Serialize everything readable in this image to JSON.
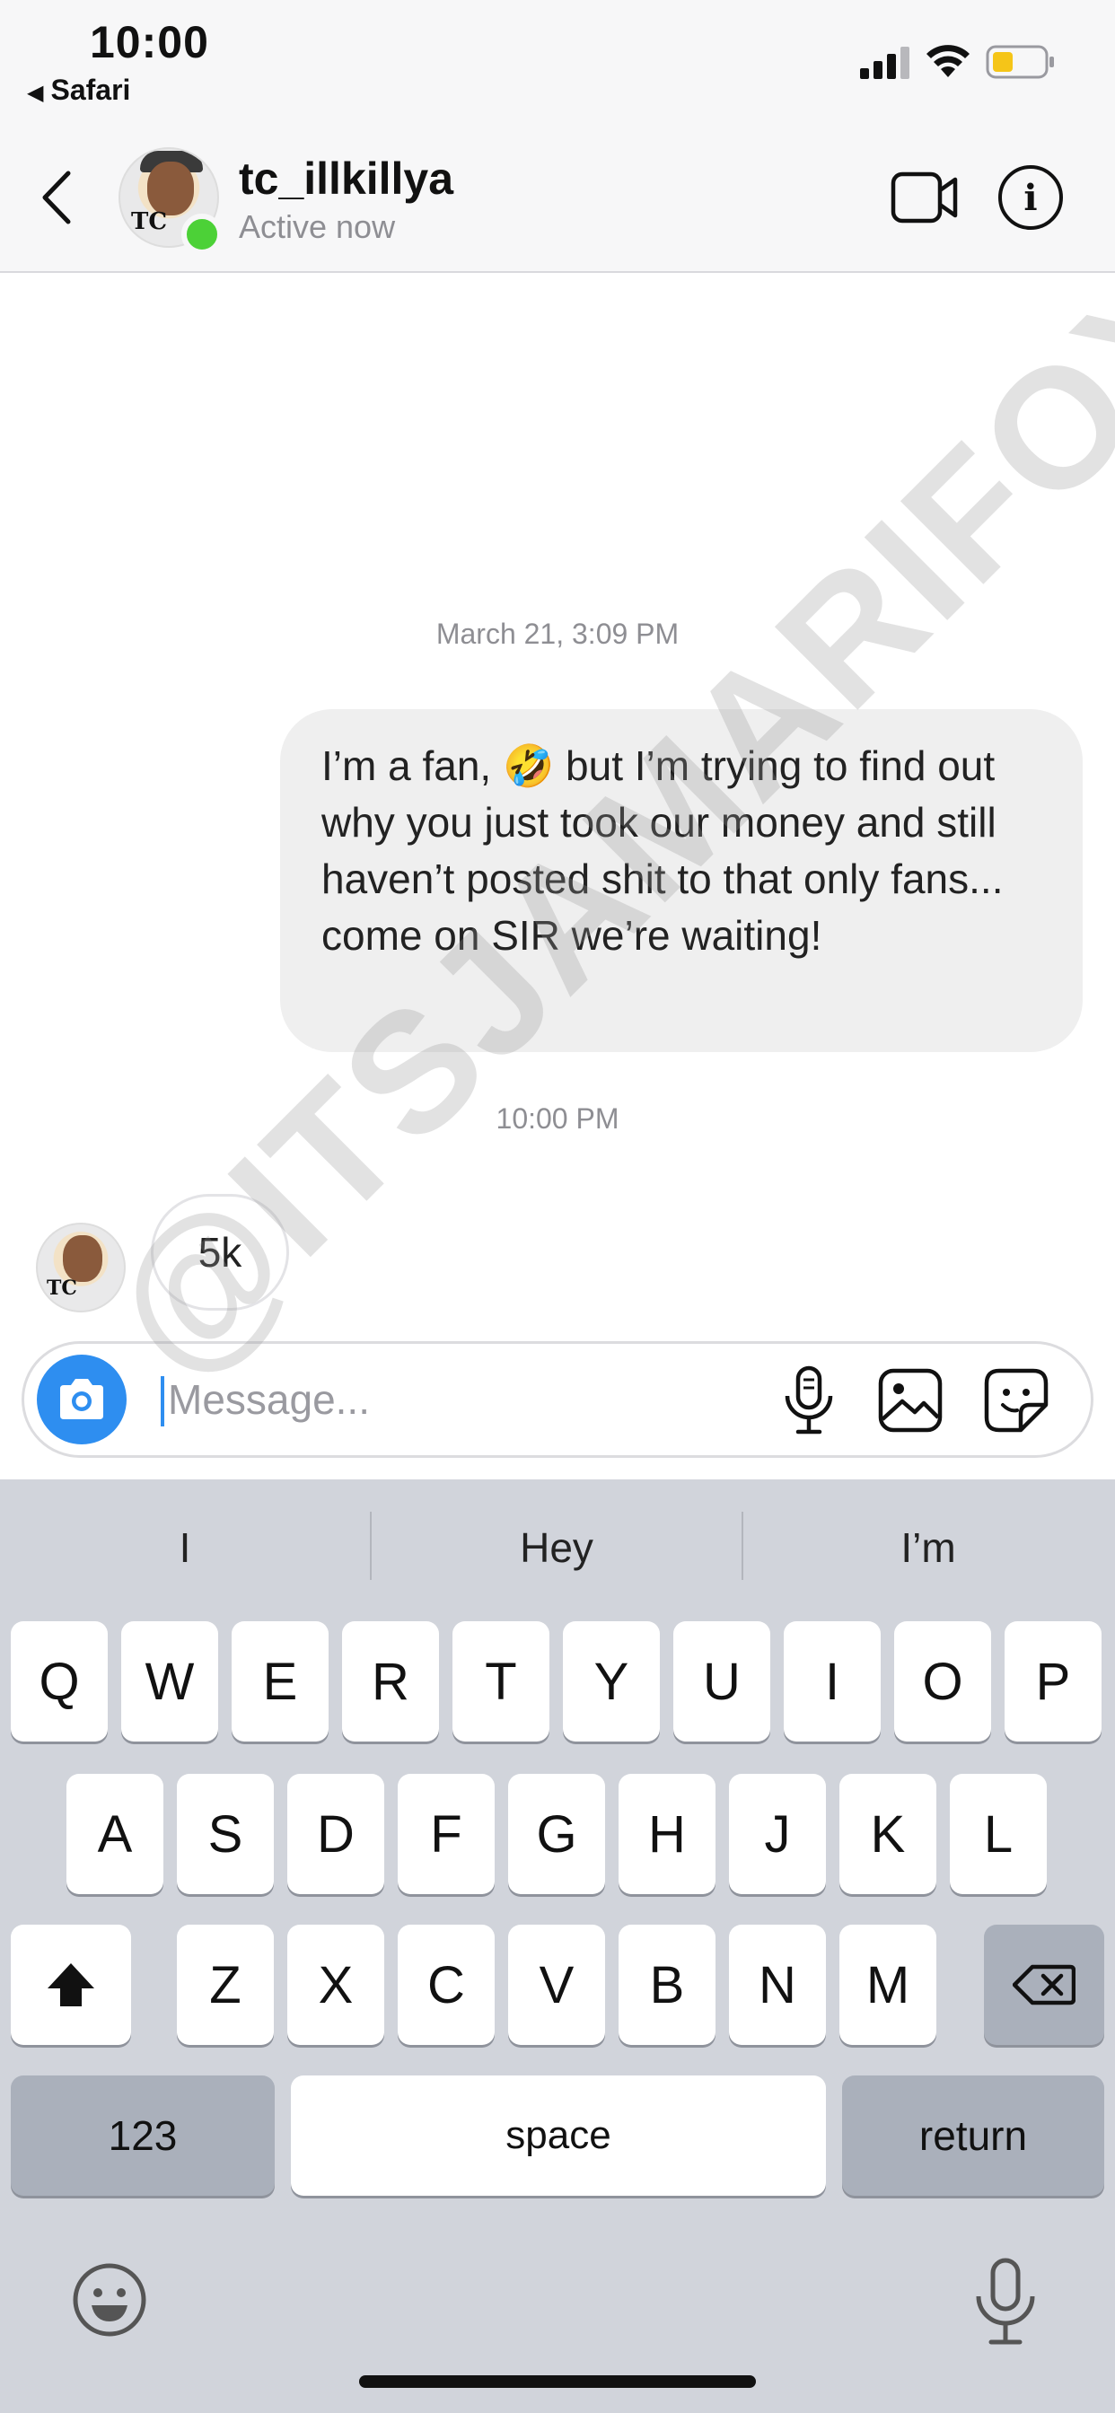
{
  "status_bar": {
    "time": "10:00",
    "back_app": "Safari",
    "battery_color": "#f5c518"
  },
  "header": {
    "username": "tc_illkillya",
    "status": "Active now",
    "avatar_badge": "TC",
    "online_color": "#4cd137"
  },
  "chat": {
    "date_stamp": "March 21, 3:09 PM",
    "outgoing_message": "I’m a fan, 🤣 but I’m trying to find out why you just took our money and still haven’t posted shit to that only fans... come on SIR we’re waiting!",
    "time_stamp": "10:00 PM",
    "incoming_message": "5k",
    "incoming_avatar_badge": "TC"
  },
  "composer": {
    "placeholder": "Message...",
    "value": "",
    "accent_color": "#2e8ef0"
  },
  "keyboard": {
    "suggestions": [
      "I",
      "Hey",
      "I’m"
    ],
    "row1": [
      "Q",
      "W",
      "E",
      "R",
      "T",
      "Y",
      "U",
      "I",
      "O",
      "P"
    ],
    "row2": [
      "A",
      "S",
      "D",
      "F",
      "G",
      "H",
      "J",
      "K",
      "L"
    ],
    "row3": [
      "Z",
      "X",
      "C",
      "V",
      "B",
      "N",
      "M"
    ],
    "numbers_label": "123",
    "space_label": "space",
    "return_label": "return"
  },
  "watermark": "@ITSJAMARIFOX"
}
